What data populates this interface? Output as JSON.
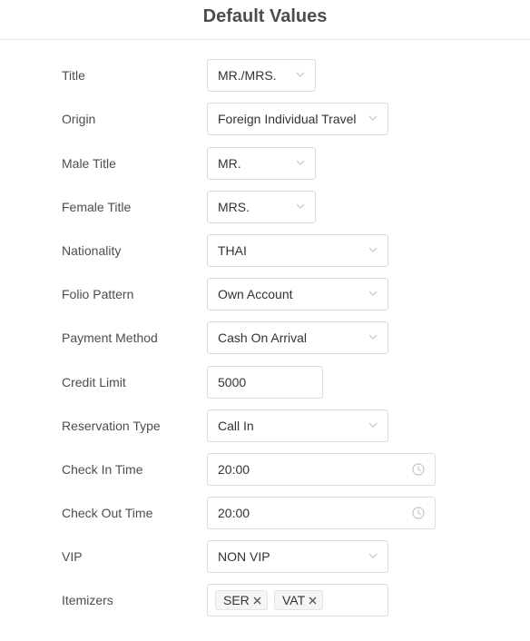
{
  "header": {
    "title": "Default Values"
  },
  "fields": {
    "title": {
      "label": "Title",
      "value": "MR./MRS."
    },
    "origin": {
      "label": "Origin",
      "value": "Foreign Individual Travel"
    },
    "male_title": {
      "label": "Male Title",
      "value": "MR."
    },
    "female_title": {
      "label": "Female Title",
      "value": "MRS."
    },
    "nationality": {
      "label": "Nationality",
      "value": "THAI"
    },
    "folio_pattern": {
      "label": "Folio Pattern",
      "value": "Own Account"
    },
    "payment_method": {
      "label": "Payment Method",
      "value": "Cash On Arrival"
    },
    "credit_limit": {
      "label": "Credit Limit",
      "value": "5000"
    },
    "reservation_type": {
      "label": "Reservation Type",
      "value": "Call In"
    },
    "check_in_time": {
      "label": "Check In Time",
      "value": "20:00"
    },
    "check_out_time": {
      "label": "Check Out Time",
      "value": "20:00"
    },
    "vip": {
      "label": "VIP",
      "value": "NON VIP"
    },
    "itemizers": {
      "label": "Itemizers",
      "tags": [
        "SER",
        "VAT"
      ]
    }
  },
  "icons": {
    "dropdown": "chevron-down-icon",
    "time": "clock-icon",
    "remove_tag": "close-icon"
  },
  "colors": {
    "text": "#333333",
    "label": "#4d4d4d",
    "border": "#dcdcdc",
    "icon": "#c0c4cc",
    "tag_bg": "#f5f5f5"
  }
}
